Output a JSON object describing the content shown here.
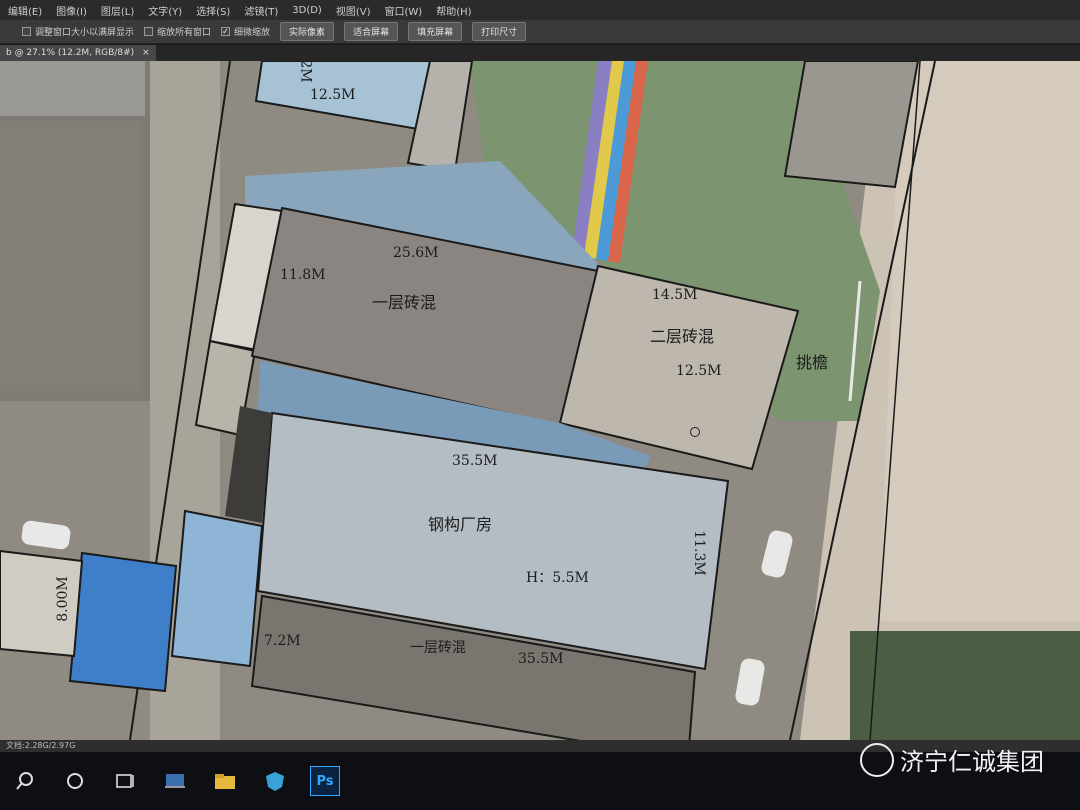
{
  "menubar": {
    "items": [
      "编辑(E)",
      "图像(I)",
      "图层(L)",
      "文字(Y)",
      "选择(S)",
      "滤镜(T)",
      "3D(D)",
      "视图(V)",
      "窗口(W)",
      "帮助(H)"
    ]
  },
  "options": {
    "check1": "调整窗口大小以满屏显示",
    "check2": "缩放所有窗口",
    "check3": "细微缩放",
    "btn1": "实际像素",
    "btn2": "适合屏幕",
    "btn3": "填充屏幕",
    "btn4": "打印尺寸"
  },
  "doc_tab": {
    "title": "b @ 27.1% (12.2M, RGB/8#)",
    "close": "×"
  },
  "map": {
    "labels": {
      "top_left_width": "12.5M",
      "top_left_rotated": "2M",
      "b1_top": "25.6M",
      "b1_side": "11.8M",
      "b1_type": "一层砖混",
      "b2_top": "14.5M",
      "b2_type": "二层砖混",
      "b2_side": "12.5M",
      "eaves": "挑檐",
      "steel_top": "35.5M",
      "steel_type": "钢构厂房",
      "steel_height": "H：5.5M",
      "steel_side": "11.3M",
      "left_rotated": "8.00M",
      "bottom_side": "7.2M",
      "bottom_type": "一层砖混",
      "bottom_top": "35.5M"
    }
  },
  "status": {
    "text": "文档:2.28G/2.97G"
  },
  "taskbar": {
    "icons": [
      "search-icon",
      "task-view-icon",
      "desktop-icon",
      "file-explorer-icon",
      "defender-icon",
      "photoshop-icon"
    ],
    "ps_label": "Ps"
  },
  "watermark": {
    "text": "济宁仁诚集团"
  }
}
